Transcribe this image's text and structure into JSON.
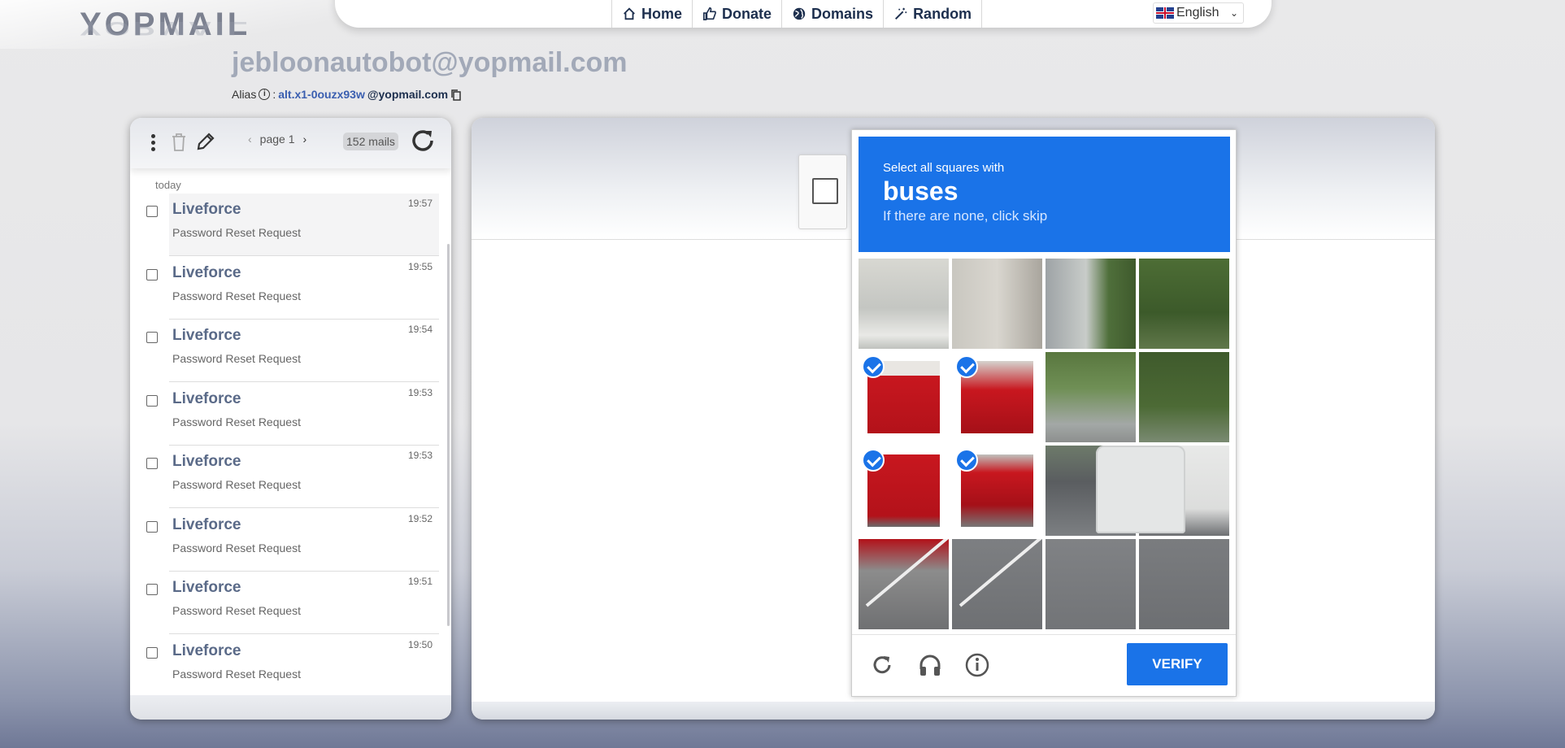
{
  "header": {
    "logo_text": "YOPMAIL",
    "nav": [
      {
        "label": "Home",
        "icon": "home-icon"
      },
      {
        "label": "Donate",
        "icon": "thumbs-up-icon"
      },
      {
        "label": "Domains",
        "icon": "globe-icon"
      },
      {
        "label": "Random",
        "icon": "magic-wand-icon"
      }
    ],
    "language": "English"
  },
  "account": {
    "email": "jebloonautobot@yopmail.com",
    "alias_label": "Alias",
    "alias_sep": ":",
    "alias_value": "alt.x1-0ouzx93w",
    "alias_domain": "@yopmail.com"
  },
  "inbox": {
    "page_label": "page 1",
    "count_label": "152 mails",
    "day_label": "today",
    "mails": [
      {
        "sender": "Liveforce",
        "subject": "Password Reset Request",
        "time": "19:57"
      },
      {
        "sender": "Liveforce",
        "subject": "Password Reset Request",
        "time": "19:55"
      },
      {
        "sender": "Liveforce",
        "subject": "Password Reset Request",
        "time": "19:54"
      },
      {
        "sender": "Liveforce",
        "subject": "Password Reset Request",
        "time": "19:53"
      },
      {
        "sender": "Liveforce",
        "subject": "Password Reset Request",
        "time": "19:53"
      },
      {
        "sender": "Liveforce",
        "subject": "Password Reset Request",
        "time": "19:52"
      },
      {
        "sender": "Liveforce",
        "subject": "Password Reset Request",
        "time": "19:51"
      },
      {
        "sender": "Liveforce",
        "subject": "Password Reset Request",
        "time": "19:50"
      }
    ]
  },
  "captcha": {
    "instruction": "Select all squares with",
    "target": "buses",
    "hint": "If there are none, click skip",
    "verify_label": "VERIFY",
    "accent_color": "#1a73e8",
    "selected_tiles": [
      4,
      5,
      8,
      9
    ]
  }
}
